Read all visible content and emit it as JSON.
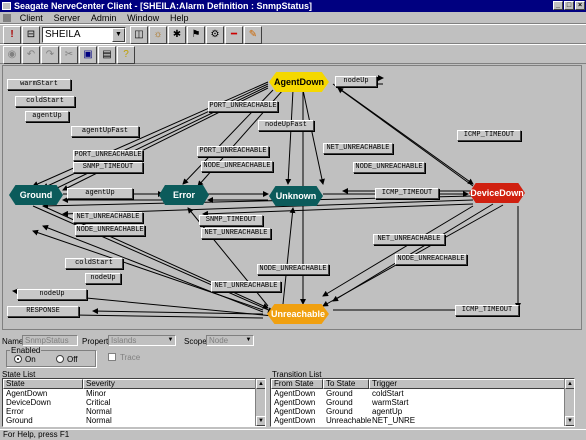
{
  "window": {
    "title": "Seagate NerveCenter Client - [SHEILA:Alarm Definition : SnmpStatus]"
  },
  "menu": [
    "Client",
    "Server",
    "Admin",
    "Window",
    "Help"
  ],
  "toolbar": {
    "server": "SHEILA"
  },
  "colors": {
    "ground": "#0b5b5b",
    "error": "#0b5b5b",
    "unknown": "#0b5b5b",
    "agentdown": "#f5d800",
    "devicedown": "#d02010",
    "unreachable": "#f0a010"
  },
  "states": [
    {
      "id": "agentdown",
      "label": "AgentDown"
    },
    {
      "id": "ground",
      "label": "Ground"
    },
    {
      "id": "error",
      "label": "Error"
    },
    {
      "id": "unknown",
      "label": "Unknown"
    },
    {
      "id": "devicedown",
      "label": "DeviceDown"
    },
    {
      "id": "unreachable",
      "label": "Unreachable"
    }
  ],
  "transitions": [
    "warmStart",
    "coldStart",
    "agentUp",
    "agentUpFast",
    "PORT_UNREACHABLE",
    "SNMP_TIMEOUT",
    "agentUp",
    "NET_UNREACHABLE",
    "NODE_UNREACHABLE",
    "coldStart",
    "nodeUp",
    "nodeUp",
    "RESPONSE",
    "nodeUp",
    "PORT_UNREACHABLE",
    "nodeUpFast",
    "NET_UNREACHABLE",
    "NODE_UNREACHABLE",
    "PORT_UNREACHABLE",
    "NODE_UNREACHABLE",
    "SNMP_TIMEOUT",
    "NET_UNREACHABLE",
    "ICMP_TIMEOUT",
    "ICMP_TIMEOUT",
    "NET_UNREACHABLE",
    "NODE_UNREACHABLE",
    "NODE_UNREACHABLE",
    "NET_UNREACHABLE",
    "ICMP_TIMEOUT"
  ],
  "form": {
    "name_label": "Name",
    "name_value": "SnmpStatus",
    "property_label": "Property",
    "property_value": "Islands",
    "scope_label": "Scope",
    "scope_value": "Node",
    "enabled_label": "Enabled",
    "on_label": "On",
    "off_label": "Off",
    "trace_label": "Trace"
  },
  "state_list": {
    "title": "State List",
    "columns": [
      "State",
      "Severity"
    ],
    "rows": [
      [
        "AgentDown",
        "Minor"
      ],
      [
        "DeviceDown",
        "Critical"
      ],
      [
        "Error",
        "Normal"
      ],
      [
        "Ground",
        "Normal"
      ]
    ]
  },
  "transition_list": {
    "title": "Transition List",
    "columns": [
      "From State",
      "To State",
      "Trigger"
    ],
    "rows": [
      [
        "AgentDown",
        "Ground",
        "coldStart"
      ],
      [
        "AgentDown",
        "Ground",
        "warmStart"
      ],
      [
        "AgentDown",
        "Ground",
        "agentUp"
      ],
      [
        "AgentDown",
        "Unreachable",
        "NET_UNRE"
      ]
    ]
  },
  "status": "For Help, press F1"
}
